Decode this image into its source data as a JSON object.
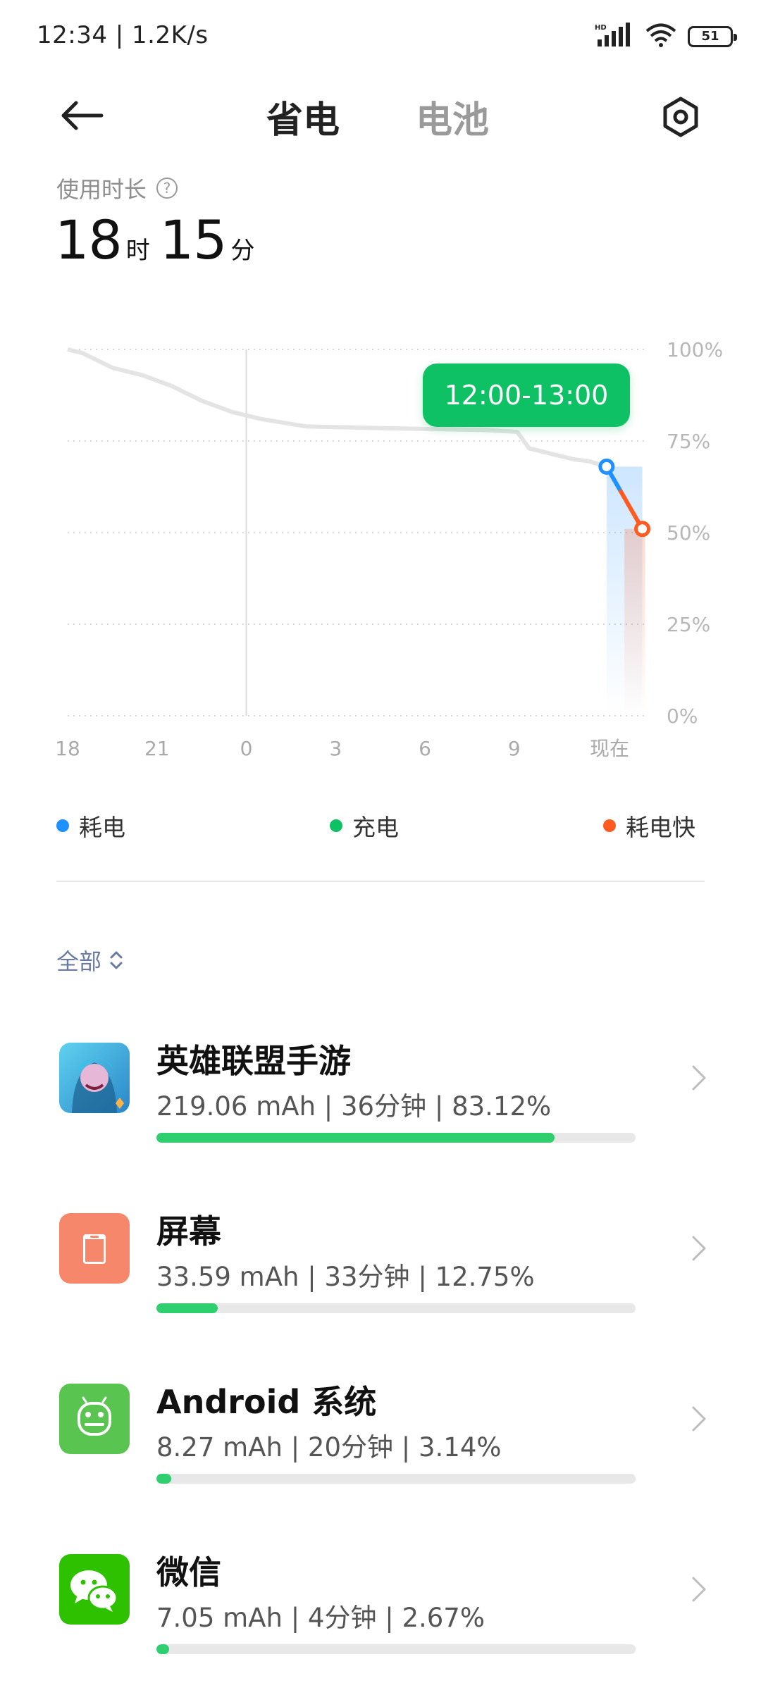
{
  "status_bar": {
    "time": "12:34 | 1.2K/s",
    "battery": "51",
    "hd": "HD"
  },
  "header": {
    "tab_active": "省电",
    "tab_inactive": "电池"
  },
  "usage": {
    "label": "使用时长",
    "help": "?",
    "hours": "18",
    "hours_unit": "时",
    "minutes": "15",
    "minutes_unit": "分"
  },
  "chart_data": {
    "type": "line",
    "tooltip": "12:00-13:00",
    "y_ticks": [
      "100%",
      "75%",
      "50%",
      "25%",
      "0%"
    ],
    "x_ticks": [
      "18",
      "21",
      "0",
      "3",
      "6",
      "9",
      "现在"
    ],
    "ylim": [
      0,
      100
    ],
    "xlim": [
      18,
      37.5
    ],
    "series": [
      {
        "name": "耗电",
        "color": "#1e90ff",
        "x": [
          18,
          18.5,
          19.5,
          20.5,
          21.5,
          22.5,
          23.5,
          24.5,
          26,
          28,
          30,
          32,
          33.1,
          33.5,
          34.5,
          35,
          35.5,
          36.1
        ],
        "y": [
          100,
          99,
          95,
          93,
          90,
          86,
          83,
          81,
          79,
          78.6,
          78.3,
          78,
          77.5,
          73,
          71,
          70,
          69.5,
          68
        ]
      },
      {
        "name": "耗电快",
        "color": "#ff5a1f",
        "x": [
          36.1,
          37.3
        ],
        "y": [
          68,
          51
        ]
      }
    ],
    "legend": [
      "耗电",
      "充电",
      "耗电快"
    ],
    "legend_colors": [
      "#1e90ff",
      "#0ec164",
      "#ff5a1f"
    ],
    "grid": true
  },
  "filter": {
    "label": "全部"
  },
  "apps": [
    {
      "name": "英雄联盟手游",
      "stats": "219.06 mAh | 36分钟 | 83.12%",
      "percent": 83.12,
      "icon": "game-icon",
      "color": "#3fb8d8"
    },
    {
      "name": "屏幕",
      "stats": "33.59 mAh | 33分钟 | 12.75%",
      "percent": 12.75,
      "icon": "screen-icon",
      "color": "#f7876a"
    },
    {
      "name": "Android 系统",
      "stats": "8.27 mAh | 20分钟 | 3.14%",
      "percent": 3.14,
      "icon": "android-icon",
      "color": "#5ac450"
    },
    {
      "name": "微信",
      "stats": "7.05 mAh | 4分钟 | 2.67%",
      "percent": 2.67,
      "icon": "wechat-icon",
      "color": "#2dc100"
    }
  ]
}
